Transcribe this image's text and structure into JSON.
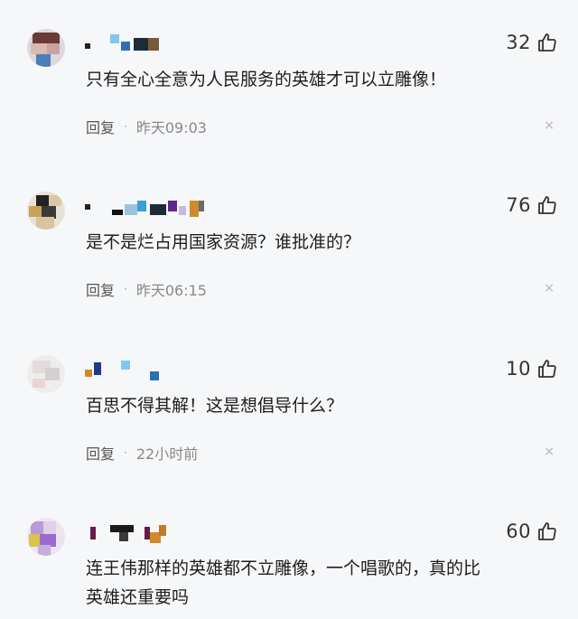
{
  "comments": [
    {
      "likes": "32",
      "text": "只有全心全意为人民服务的英雄才可以立雕像！",
      "reply_label": "回复",
      "separator": "·",
      "time": "昨天09:03",
      "close_glyph": "×"
    },
    {
      "likes": "76",
      "text": "是不是烂占用国家资源？谁批准的？",
      "reply_label": "回复",
      "separator": "·",
      "time": "昨天06:15",
      "close_glyph": "×"
    },
    {
      "likes": "10",
      "text": "百思不得其解！这是想倡导什么？",
      "reply_label": "回复",
      "separator": "·",
      "time": "22小时前",
      "close_glyph": "×"
    },
    {
      "likes": "60",
      "text": "连王伟那样的英雄都不立雕像，一个唱歌的，真的比英雄还重要吗"
    }
  ],
  "icons": {
    "like": "thumbs-up-icon",
    "close": "close-icon"
  },
  "colors": {
    "background": "#f6f7f9",
    "text": "#1d1d1d",
    "meta": "#888888"
  }
}
